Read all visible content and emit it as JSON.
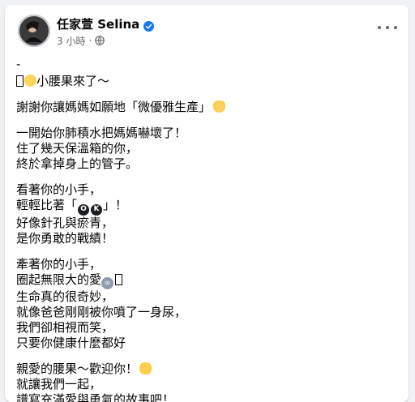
{
  "post": {
    "author": "任家萱 Selina",
    "time_ago": "3 小時",
    "separator": "·"
  },
  "paragraphs": [
    {
      "lines": [
        "-"
      ]
    },
    {
      "lines": [
        "小腰果來了～"
      ]
    },
    {
      "lines": [
        "謝謝你讓媽媽如願地「微優雅生產」"
      ]
    },
    {
      "lines": [
        "一開始你肺積水把媽媽嚇壞了！",
        "住了幾天保溫箱的你，",
        "終於拿掉身上的管子。"
      ]
    },
    {
      "lines": [
        "看著你的小手，",
        "輕輕比著「",
        "好像針孔與瘀青，",
        "是你勇敢的戰績！"
      ]
    },
    {
      "lines": [
        "牽著你的小手，",
        "圈起無限大的愛",
        "生命真的很奇妙，",
        "就像爸爸剛剛被你噴了一身尿，",
        "我們卻相視而笑，",
        "只要你健康什麼都好"
      ]
    },
    {
      "lines": [
        "親愛的腰果～歡迎你！",
        "就讓我們一起，",
        "譜寫充滿愛與勇氣的故事吧！"
      ]
    }
  ],
  "inline": {
    "ok_open_end": "」！",
    "ok_letters": [
      "O",
      "K"
    ]
  },
  "icons": [
    "avatar",
    "verified-badge-icon",
    "globe-icon",
    "more-options-icon",
    "chick-emoji",
    "heart-hands-emoji",
    "ok-emoji",
    "infinity-emoji",
    "clapping-hands-emoji"
  ],
  "colors": {
    "verified": "#1877f2",
    "meta": "#65676b",
    "text": "#050505",
    "background": "#f0f2f5"
  }
}
